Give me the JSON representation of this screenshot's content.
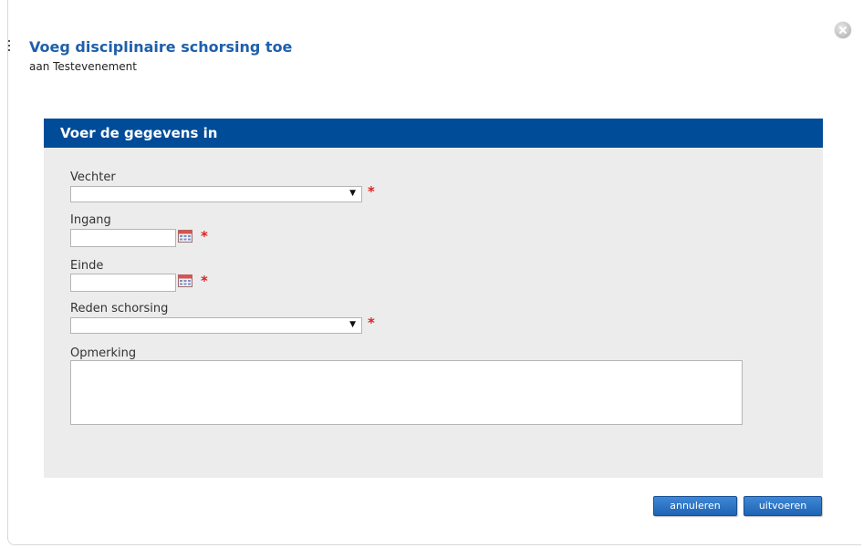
{
  "dialog": {
    "title": "Voeg disciplinaire schorsing toe",
    "subtitle": "aan Testevenement"
  },
  "panel": {
    "header": "Voer de gegevens in"
  },
  "fields": {
    "fighter": {
      "label": "Vechter",
      "value": "",
      "required_mark": "*"
    },
    "start": {
      "label": "Ingang",
      "value": "",
      "required_mark": "*"
    },
    "end": {
      "label": "Einde",
      "value": "",
      "required_mark": "*"
    },
    "reason": {
      "label": "Reden schorsing",
      "value": "",
      "required_mark": "*"
    },
    "remark": {
      "label": "Opmerking",
      "value": ""
    }
  },
  "icons": {
    "close": "close-icon",
    "calendar": "calendar-icon",
    "dropdown": "chevron-down-icon"
  },
  "buttons": {
    "cancel": "annuleren",
    "submit": "uitvoeren"
  },
  "colors": {
    "title": "#1f5fab",
    "header_bg": "#004c98",
    "panel_bg": "#ececec",
    "required": "#e02020",
    "button": "#2a74c6"
  }
}
